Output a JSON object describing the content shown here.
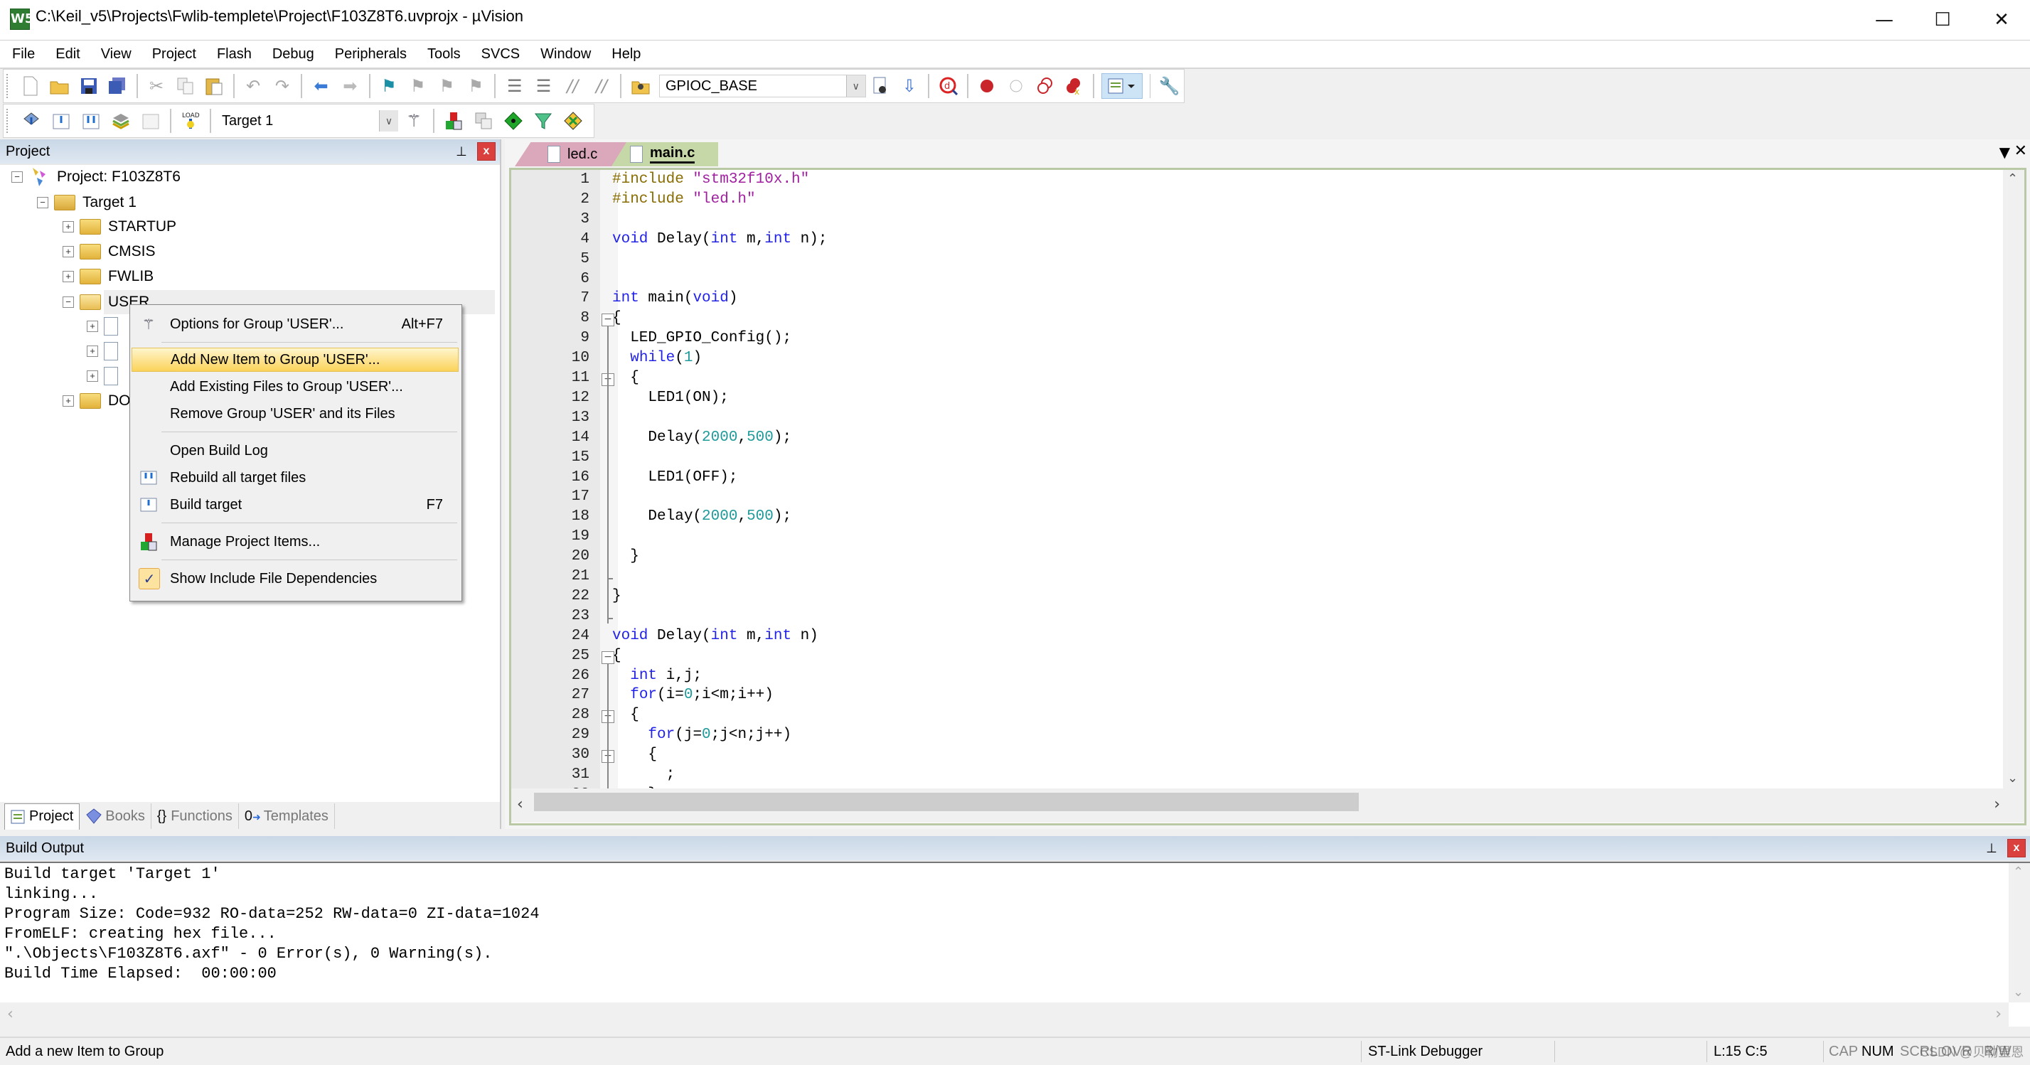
{
  "window": {
    "title": "C:\\Keil_v5\\Projects\\Fwlib-templete\\Project\\F103Z8T6.uvprojx - µVision",
    "app_icon": "W5",
    "controls": {
      "minimize": "—",
      "maximize": "☐",
      "close": "✕"
    }
  },
  "menubar": [
    "File",
    "Edit",
    "View",
    "Project",
    "Flash",
    "Debug",
    "Peripherals",
    "Tools",
    "SVCS",
    "Window",
    "Help"
  ],
  "toolbar1": {
    "find_combo_value": "GPIOC_BASE",
    "icons": [
      "new-file",
      "open-file",
      "save",
      "save-all",
      "cut",
      "copy",
      "paste",
      "undo",
      "redo",
      "navigate-back",
      "navigate-forward",
      "insert-bookmark",
      "previous-bookmark",
      "next-bookmark",
      "clear-bookmarks",
      "indent",
      "unindent",
      "comment",
      "uncomment",
      "find-in-files",
      "find",
      "incremental-find",
      "debug-session",
      "insert-breakpoint",
      "enable-breakpoint",
      "disable-breakpoints",
      "kill-breakpoints",
      "window-layout",
      "configure"
    ]
  },
  "toolbar2": {
    "target_combo_value": "Target 1",
    "icons": [
      "translate",
      "build",
      "rebuild",
      "batch-build",
      "stop-build",
      "download",
      "target-options",
      "manage-project-items",
      "select-packs",
      "manage-rte",
      "pack-installer"
    ]
  },
  "project_panel": {
    "title": "Project",
    "tree": [
      {
        "label": "Project: F103Z8T6",
        "level": 0,
        "expanded": true,
        "icon": "project"
      },
      {
        "label": "Target 1",
        "level": 1,
        "expanded": true,
        "icon": "target-folder"
      },
      {
        "label": "STARTUP",
        "level": 2,
        "expanded": false,
        "icon": "folder"
      },
      {
        "label": "CMSIS",
        "level": 2,
        "expanded": false,
        "icon": "folder"
      },
      {
        "label": "FWLIB",
        "level": 2,
        "expanded": false,
        "icon": "folder"
      },
      {
        "label": "USER",
        "level": 2,
        "expanded": true,
        "icon": "open-folder",
        "selected": true
      },
      {
        "label": "",
        "level": 3,
        "expanded": false,
        "icon": "file"
      },
      {
        "label": "",
        "level": 3,
        "expanded": false,
        "icon": "file"
      },
      {
        "label": "",
        "level": 3,
        "expanded": false,
        "icon": "file"
      },
      {
        "label": "DO",
        "level": 2,
        "expanded": false,
        "icon": "folder"
      }
    ],
    "tabs": [
      {
        "label": "Project",
        "active": true
      },
      {
        "label": "Books",
        "active": false
      },
      {
        "label": "Functions",
        "active": false
      },
      {
        "label": "Templates",
        "active": false
      }
    ]
  },
  "context_menu": {
    "items": [
      {
        "label": "Options for Group 'USER'...",
        "shortcut": "Alt+F7",
        "icon": "magic-wand"
      },
      {
        "separator": true
      },
      {
        "label": "Add New  Item to Group 'USER'...",
        "highlighted": true
      },
      {
        "label": "Add Existing Files to Group 'USER'..."
      },
      {
        "label": "Remove Group 'USER' and its Files"
      },
      {
        "separator": true
      },
      {
        "label": "Open Build Log"
      },
      {
        "label": "Rebuild all target files",
        "icon": "rebuild"
      },
      {
        "label": "Build target",
        "shortcut": "F7",
        "icon": "build"
      },
      {
        "separator": true
      },
      {
        "label": "Manage Project Items...",
        "icon": "manage-items"
      },
      {
        "separator": true
      },
      {
        "label": "Show Include File Dependencies",
        "icon": "checkmark",
        "checked": true
      }
    ]
  },
  "editor": {
    "tabs": [
      {
        "label": "led.c",
        "active": false,
        "color": "#d9a5b8"
      },
      {
        "label": "main.c",
        "active": true,
        "color": "#c4d6a4"
      }
    ],
    "lines": [
      [
        {
          "t": "#include ",
          "c": "pp"
        },
        {
          "t": "\"stm32f10x.h\"",
          "c": "str"
        }
      ],
      [
        {
          "t": "#include ",
          "c": "pp"
        },
        {
          "t": "\"led.h\"",
          "c": "str"
        }
      ],
      [],
      [
        {
          "t": "void",
          "c": "kw"
        },
        {
          "t": " Delay("
        },
        {
          "t": "int",
          "c": "kw"
        },
        {
          "t": " m,"
        },
        {
          "t": "int",
          "c": "kw"
        },
        {
          "t": " n);"
        }
      ],
      [],
      [],
      [
        {
          "t": "int",
          "c": "kw"
        },
        {
          "t": " main("
        },
        {
          "t": "void",
          "c": "kw"
        },
        {
          "t": ")"
        }
      ],
      [
        {
          "t": "{"
        }
      ],
      [
        {
          "t": "  LED_GPIO_Config();"
        }
      ],
      [
        {
          "t": "  "
        },
        {
          "t": "while",
          "c": "kw"
        },
        {
          "t": "("
        },
        {
          "t": "1",
          "c": "num"
        },
        {
          "t": ")"
        }
      ],
      [
        {
          "t": "  {"
        }
      ],
      [
        {
          "t": "    LED1(ON);"
        }
      ],
      [],
      [
        {
          "t": "    Delay("
        },
        {
          "t": "2000",
          "c": "num"
        },
        {
          "t": ","
        },
        {
          "t": "500",
          "c": "num"
        },
        {
          "t": ");"
        }
      ],
      [],
      [
        {
          "t": "    LED1(OFF);"
        }
      ],
      [],
      [
        {
          "t": "    Delay("
        },
        {
          "t": "2000",
          "c": "num"
        },
        {
          "t": ","
        },
        {
          "t": "500",
          "c": "num"
        },
        {
          "t": ");"
        }
      ],
      [],
      [
        {
          "t": "  }"
        }
      ],
      [],
      [
        {
          "t": "}"
        }
      ],
      [],
      [
        {
          "t": "void",
          "c": "kw"
        },
        {
          "t": " Delay("
        },
        {
          "t": "int",
          "c": "kw"
        },
        {
          "t": " m,"
        },
        {
          "t": "int",
          "c": "kw"
        },
        {
          "t": " n)"
        }
      ],
      [
        {
          "t": "{"
        }
      ],
      [
        {
          "t": "  "
        },
        {
          "t": "int",
          "c": "kw"
        },
        {
          "t": " i,j;"
        }
      ],
      [
        {
          "t": "  "
        },
        {
          "t": "for",
          "c": "kw"
        },
        {
          "t": "(i="
        },
        {
          "t": "0",
          "c": "num"
        },
        {
          "t": ";i<m;i++)"
        }
      ],
      [
        {
          "t": "  {"
        }
      ],
      [
        {
          "t": "    "
        },
        {
          "t": "for",
          "c": "kw"
        },
        {
          "t": "(j="
        },
        {
          "t": "0",
          "c": "num"
        },
        {
          "t": ";j<n;j++)"
        }
      ],
      [
        {
          "t": "    {"
        }
      ],
      [
        {
          "t": "      ;"
        }
      ],
      [
        {
          "t": "    }"
        }
      ]
    ],
    "fold_markers": [
      8,
      11,
      25,
      28,
      30
    ],
    "fold_ends": [
      21,
      23,
      32
    ]
  },
  "build_output": {
    "title": "Build Output",
    "lines": [
      "Build target 'Target 1'",
      "linking...",
      "Program Size: Code=932 RO-data=252 RW-data=0 ZI-data=1024",
      "FromELF: creating hex file...",
      "\".\\Objects\\F103Z8T6.axf\" - 0 Error(s), 0 Warning(s).",
      "Build Time Elapsed:  00:00:00"
    ]
  },
  "statusbar": {
    "message": "Add a new Item to Group",
    "debugger": "ST-Link Debugger",
    "cursor": "L:15 C:5",
    "indicators": [
      "CAP",
      "NUM",
      "SCRL",
      "OVR",
      "R/W"
    ],
    "watermark": "CSDN @贝勒里恩"
  }
}
